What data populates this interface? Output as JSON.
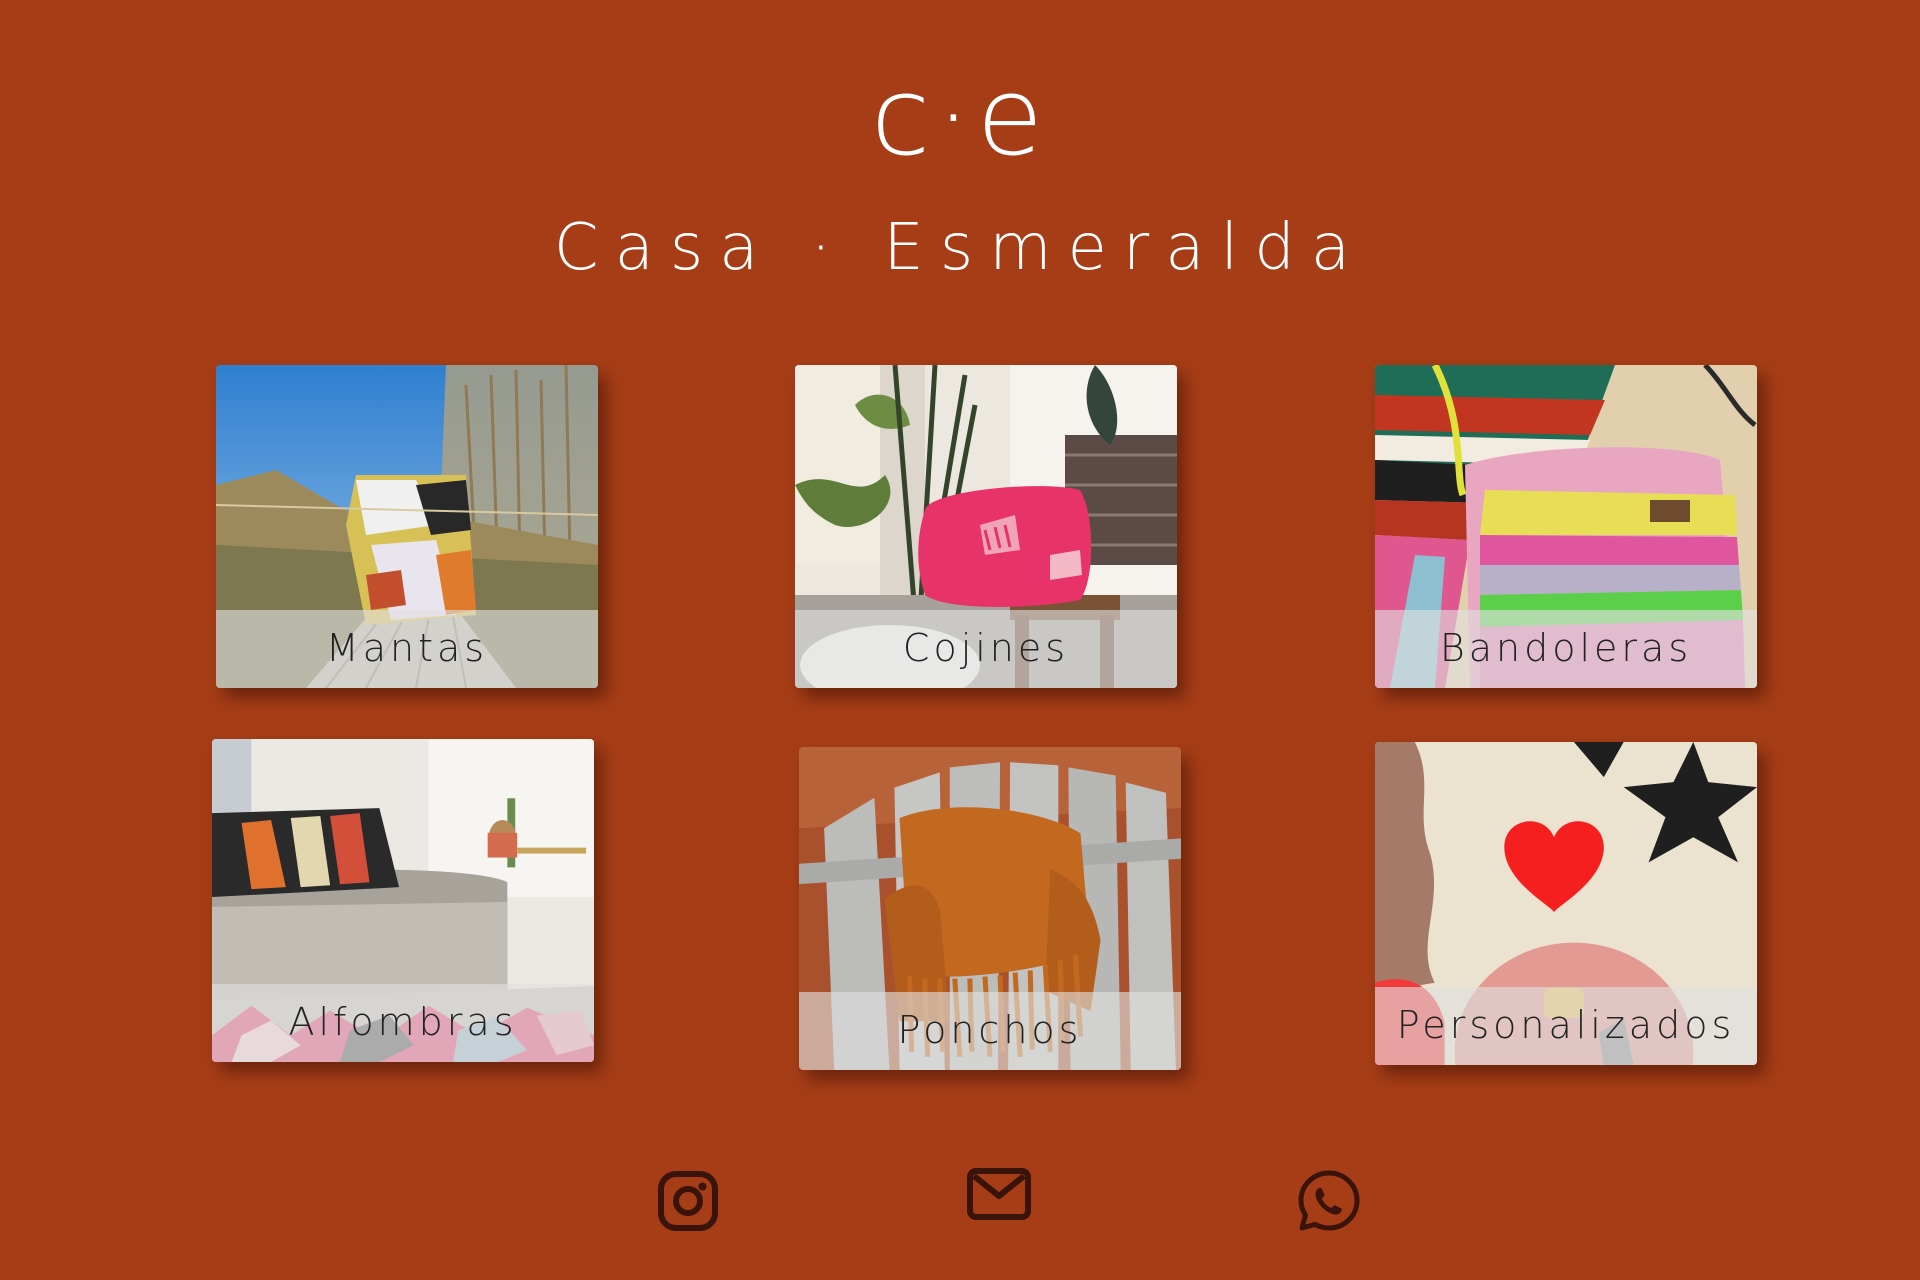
{
  "header": {
    "logo": "c·e",
    "brand": "Casa · Esmeralda"
  },
  "categories": [
    {
      "label": "Mantas"
    },
    {
      "label": "Cojines"
    },
    {
      "label": "Bandoleras"
    },
    {
      "label": "Alfombras"
    },
    {
      "label": "Ponchos"
    },
    {
      "label": "Personalizados"
    }
  ],
  "footer": {
    "icons": [
      "instagram-icon",
      "mail-icon",
      "whatsapp-icon"
    ]
  },
  "colors": {
    "background": "#a63d17",
    "text": "#ffffff",
    "icon": "#3a140a"
  }
}
